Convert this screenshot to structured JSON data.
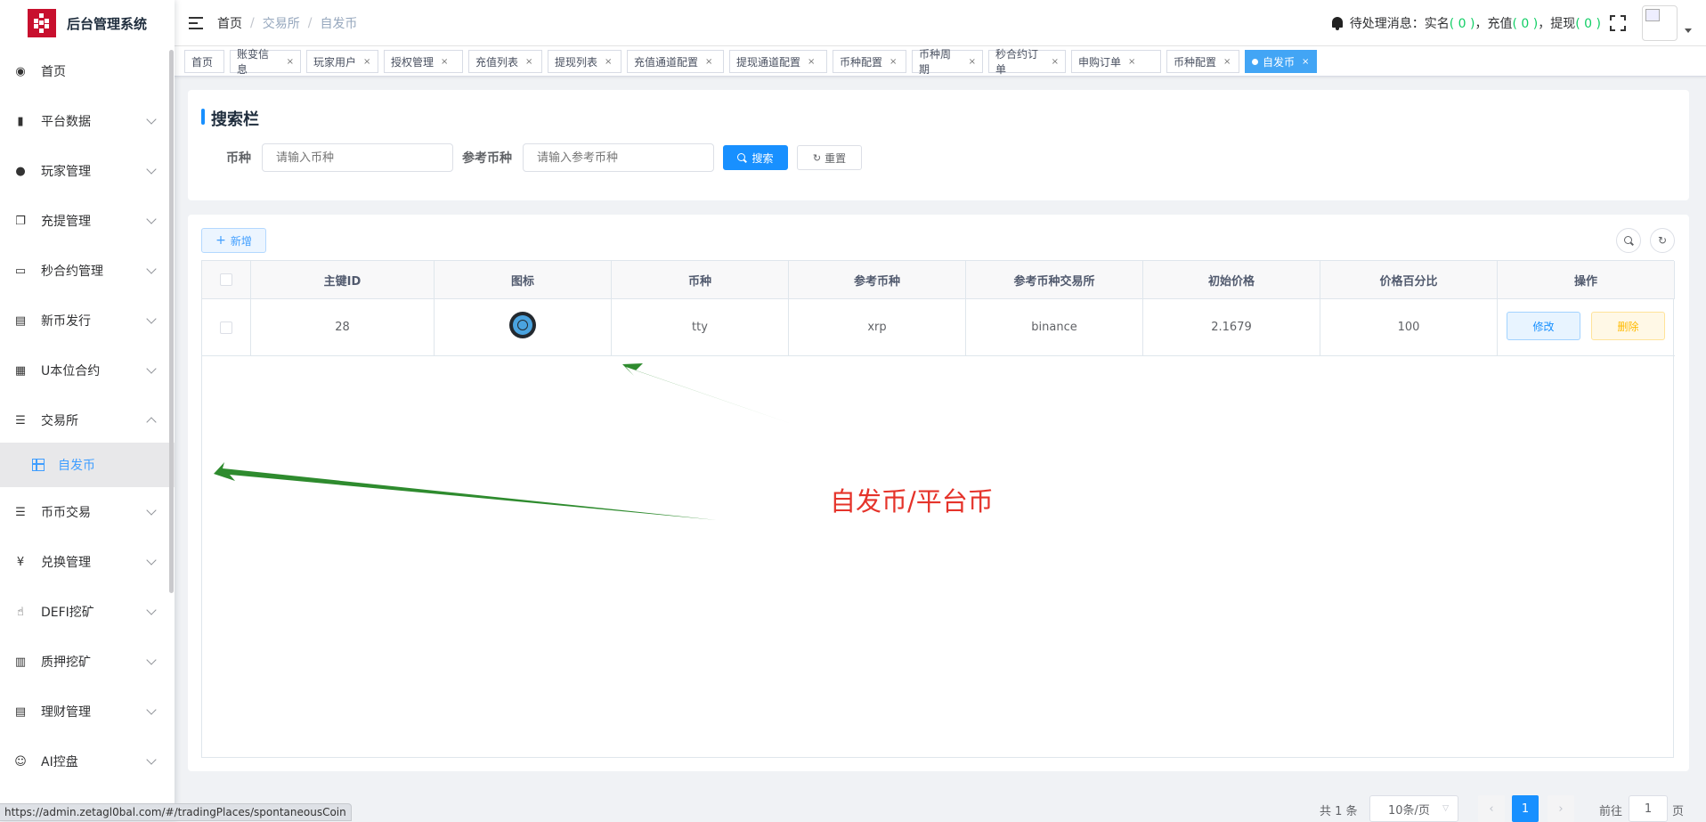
{
  "app": {
    "title": "后台管理系统"
  },
  "sidebar": {
    "items": [
      {
        "label": "首页",
        "icon": "dashboard-icon",
        "glyph": "◉",
        "expanded": false,
        "arrow": false
      },
      {
        "label": "平台数据",
        "icon": "book-icon",
        "glyph": "▮",
        "expanded": false,
        "arrow": true
      },
      {
        "label": "玩家管理",
        "icon": "user-icon",
        "glyph": "●",
        "expanded": false,
        "arrow": true
      },
      {
        "label": "充提管理",
        "icon": "documents-icon",
        "glyph": "❐",
        "expanded": false,
        "arrow": true
      },
      {
        "label": "秒合约管理",
        "icon": "monitor-icon",
        "glyph": "▭",
        "expanded": false,
        "arrow": true
      },
      {
        "label": "新币发行",
        "icon": "message-icon",
        "glyph": "▤",
        "expanded": false,
        "arrow": true
      },
      {
        "label": "U本位合约",
        "icon": "table-icon",
        "glyph": "▦",
        "expanded": false,
        "arrow": true
      },
      {
        "label": "交易所",
        "icon": "tree-list-icon",
        "glyph": "☰",
        "expanded": true,
        "arrow": true
      },
      {
        "label": "币币交易",
        "icon": "list-icon",
        "glyph": "☰",
        "expanded": false,
        "arrow": true
      },
      {
        "label": "兑换管理",
        "icon": "yen-icon",
        "glyph": "¥",
        "expanded": false,
        "arrow": true
      },
      {
        "label": "DEFI挖矿",
        "icon": "hand-icon",
        "glyph": "☝",
        "expanded": false,
        "arrow": true
      },
      {
        "label": "质押挖矿",
        "icon": "bar-chart-icon",
        "glyph": "▥",
        "expanded": false,
        "arrow": true
      },
      {
        "label": "理财管理",
        "icon": "form-icon",
        "glyph": "▤",
        "expanded": false,
        "arrow": true
      },
      {
        "label": "AI控盘",
        "icon": "robot-icon",
        "glyph": "☺",
        "expanded": false,
        "arrow": true
      }
    ],
    "subitem": {
      "label": "自发币",
      "icon": "grid-icon"
    }
  },
  "navbar": {
    "breadcrumb": [
      "首页",
      "交易所",
      "自发币"
    ],
    "pending_label": "待处理消息：",
    "pending": [
      {
        "label": "实名",
        "count": "0"
      },
      {
        "label": "充值",
        "count": "0"
      },
      {
        "label": "提现",
        "count": "0"
      }
    ]
  },
  "tags": [
    {
      "label": "首页",
      "closable": false
    },
    {
      "label": "账变信息",
      "closable": true
    },
    {
      "label": "玩家用户",
      "closable": true
    },
    {
      "label": "授权管理",
      "closable": true
    },
    {
      "label": "充值列表",
      "closable": true
    },
    {
      "label": "提现列表",
      "closable": true
    },
    {
      "label": "充值通道配置",
      "closable": true
    },
    {
      "label": "提现通道配置",
      "closable": true
    },
    {
      "label": "币种配置",
      "closable": true
    },
    {
      "label": "币种周期",
      "closable": true
    },
    {
      "label": "秒合约订单",
      "closable": true
    },
    {
      "label": "申购订单",
      "closable": true
    },
    {
      "label": "币种配置",
      "closable": true
    },
    {
      "label": "自发币",
      "closable": true,
      "active": true
    }
  ],
  "search": {
    "title": "搜索栏",
    "coin_label": "币种",
    "coin_placeholder": "请输入币种",
    "ref_label": "参考币种",
    "ref_placeholder": "请输入参考币种",
    "search_button": "搜索",
    "reset_button": "重置"
  },
  "toolbar": {
    "add_button": "新增"
  },
  "table": {
    "columns": [
      "主键ID",
      "图标",
      "币种",
      "参考币种",
      "参考币种交易所",
      "初始价格",
      "价格百分比",
      "操作"
    ],
    "rows": [
      {
        "id": "28",
        "icon": "xrp-coin-icon",
        "coin": "tty",
        "ref_coin": "xrp",
        "exchange": "binance",
        "init_price": "2.1679",
        "percent": "100",
        "edit": "修改",
        "delete": "删除"
      }
    ]
  },
  "pagination": {
    "total": "共 1 条",
    "page_size": "10条/页",
    "current_page": "1",
    "goto_label": "前往",
    "goto_value": "1",
    "page_suffix": "页"
  },
  "status_url": "https://admin.zetagl0bal.com/#/tradingPlaces/spontaneousCoin",
  "annotation": "自发币/平台币",
  "colors": {
    "accent": "#1890ff",
    "annotation": "#e5332a",
    "arrow": "#2e8b2e",
    "brand": "#c8102e"
  }
}
